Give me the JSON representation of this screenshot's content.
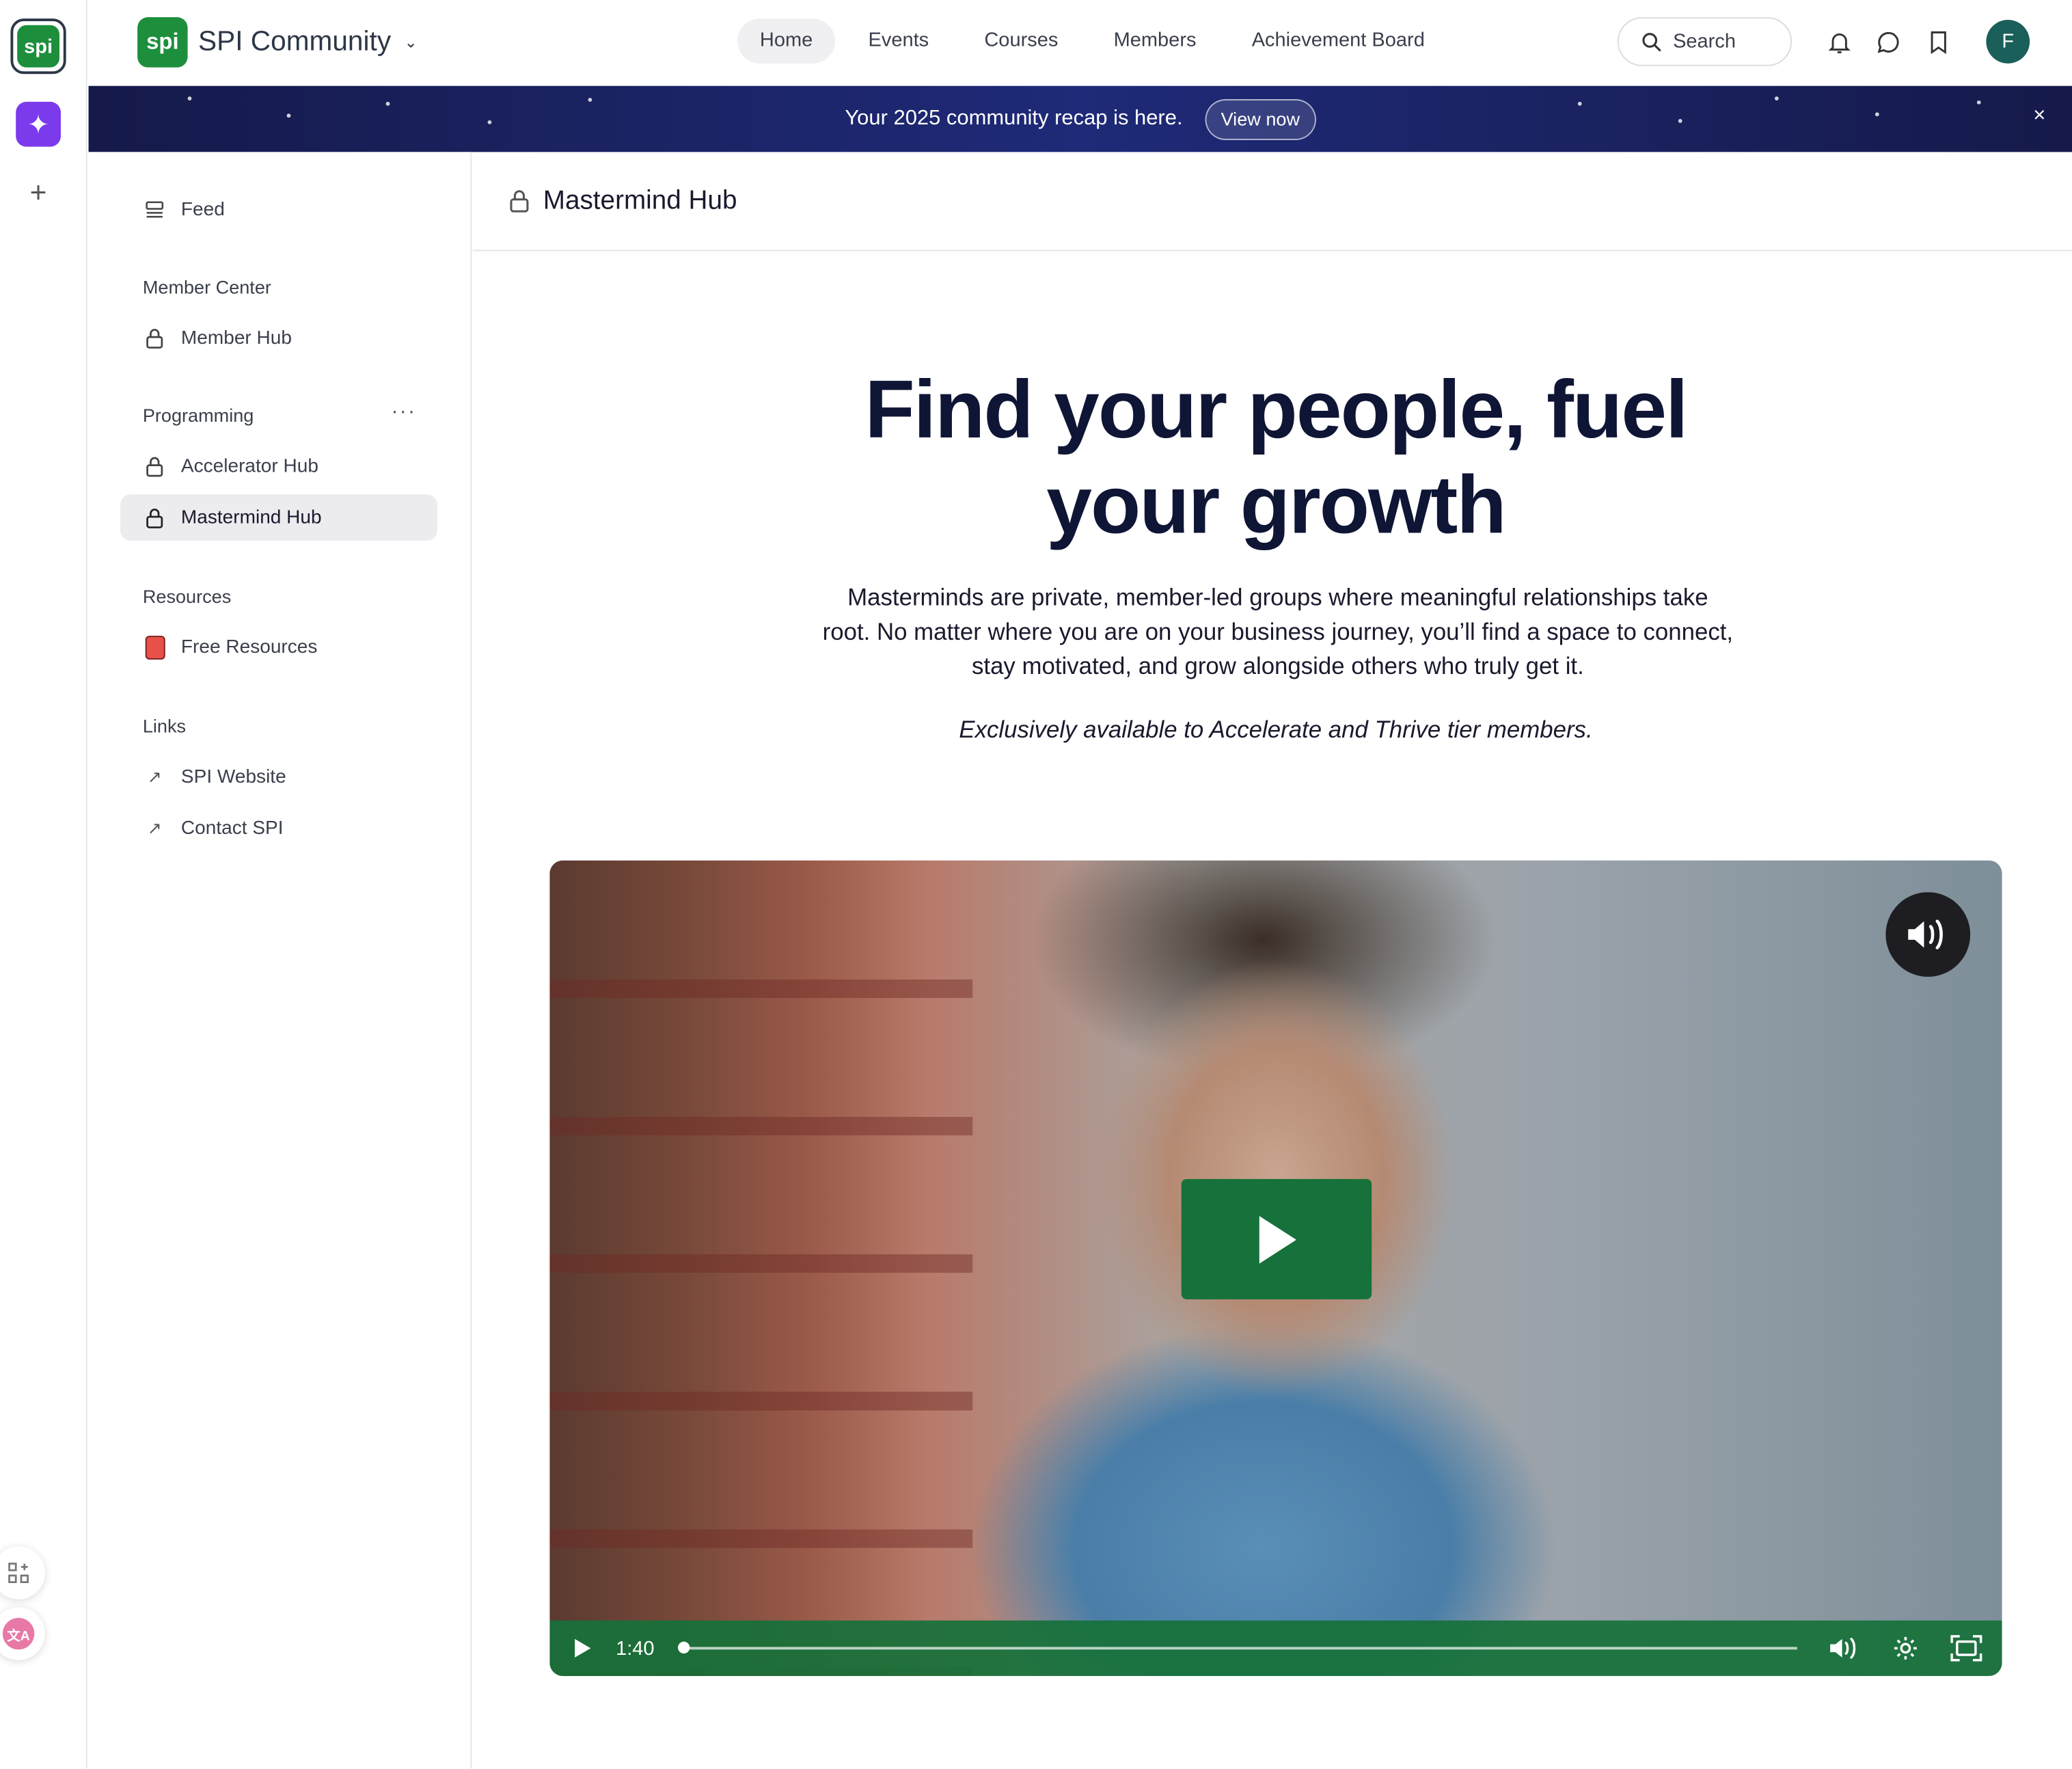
{
  "app": {
    "name": "SPI Community",
    "logo_text": "spi"
  },
  "nav": {
    "items": [
      {
        "label": "Home",
        "active": true
      },
      {
        "label": "Events",
        "active": false
      },
      {
        "label": "Courses",
        "active": false
      },
      {
        "label": "Members",
        "active": false
      },
      {
        "label": "Achievement Board",
        "active": false
      }
    ],
    "search_label": "Search",
    "avatar_initial": "F"
  },
  "banner": {
    "text": "Your 2025 community recap is here.",
    "button": "View now",
    "close": "×"
  },
  "rail": {
    "logo_text": "spi",
    "add": "+"
  },
  "sidebar": {
    "feed": "Feed",
    "sections": [
      {
        "title": "Member Center",
        "items": [
          "Member Hub"
        ]
      },
      {
        "title": "Programming",
        "items": [
          "Accelerator Hub",
          "Mastermind Hub"
        ]
      },
      {
        "title": "Resources",
        "items": [
          "Free Resources"
        ]
      },
      {
        "title": "Links",
        "items": [
          "SPI Website",
          "Contact SPI"
        ]
      }
    ],
    "active_item": "Mastermind Hub"
  },
  "main": {
    "title": "Mastermind Hub",
    "hero_line1": "Find your people, fuel",
    "hero_line2": "your growth",
    "description": "Masterminds are private, member-led groups where meaningful relationships take root. No matter where you are on your business journey, you’ll find a space to connect, stay motivated, and grow alongside others who truly get it.",
    "note": "Exclusively available to Accelerate and Thrive tier members."
  },
  "video": {
    "time": "1:40",
    "progress": 0.0,
    "accent": "#16713a"
  },
  "colors": {
    "brand_green": "#1d8f3c",
    "banner_navy": "#1f2a78",
    "hero_text": "#0f1535",
    "rail_purple": "#7c3aed"
  }
}
